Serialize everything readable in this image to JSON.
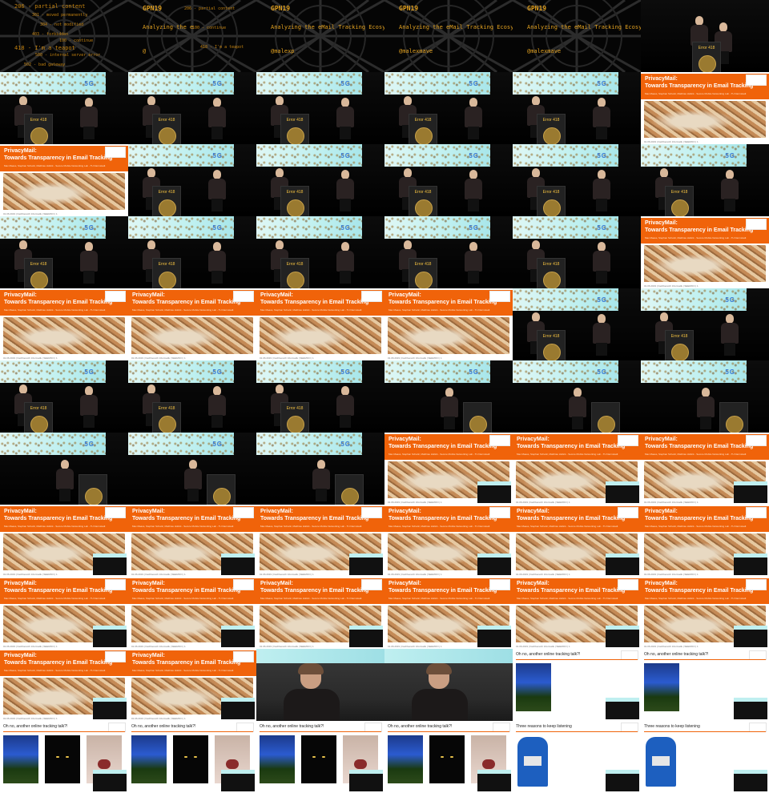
{
  "intro": {
    "conf": "GPN19",
    "talk_full": "Analyzing the eMail Tracking Ecosystem",
    "talk_partial_1": "Analyzing the e",
    "talk_partial_2": "Analyzing the eMail Tracking Ecosyste",
    "handle_full": "@malexmave",
    "handle_partial": "@malexp",
    "handle_start": "@",
    "codes": [
      "206 - partial content",
      "301 - moved permanently",
      "304 - not modified",
      "403 - forbidden",
      "100 - continue",
      "418 - I'm a teapot",
      "500 - internal server error",
      "502 - bad gateway"
    ]
  },
  "stage": {
    "sign": "Error 418",
    "screen_logo": "5G"
  },
  "slide": {
    "title_1": "PrivacyMail:",
    "title_2": "Towards Transparency in Email Tracking",
    "authors": "Max Maass, Stephan Schwär, Matthias Hollick - Secure Mobile Networking Lab - TU Darmstadt",
    "footer": "01.06.2019 | Fachbereich Informatik | SEEMOO | 1"
  },
  "question": {
    "title": "Oh no, another online tracking talk?!"
  },
  "reasons": {
    "title": "Three reasons to keep listening"
  },
  "icons": {
    "web": "spiderweb-icon",
    "crest": "university-crest-icon"
  },
  "tiles": [
    "intro-codes",
    "intro-partial-1",
    "intro-partial-2",
    "intro-full",
    "intro-full-handle",
    "stage-wide",
    "stage",
    "stage",
    "stage",
    "stage",
    "stage",
    "slide",
    "slide",
    "stage",
    "stage",
    "stage",
    "stage",
    "stage",
    "stage",
    "stage",
    "stage",
    "stage",
    "stage",
    "slide",
    "slide",
    "slide",
    "slide",
    "slide",
    "stage",
    "stage",
    "stage",
    "stage",
    "stage",
    "stage-solo",
    "stage-solo",
    "stage-solo",
    "stage-solo",
    "stage-solo",
    "stage-solo",
    "slide-pip",
    "slide-pip",
    "slide-pip",
    "slide-pip",
    "slide-pip",
    "slide-pip",
    "slide-pip",
    "slide-pip",
    "slide-pip",
    "slide-pip",
    "slide-pip",
    "slide-pip",
    "slide-pip",
    "slide-pip",
    "slide-pip",
    "slide-pip",
    "slide-pip",
    "close",
    "close",
    "question",
    "question",
    "question3",
    "question3",
    "question3",
    "question3",
    "reasons",
    "reasons"
  ]
}
